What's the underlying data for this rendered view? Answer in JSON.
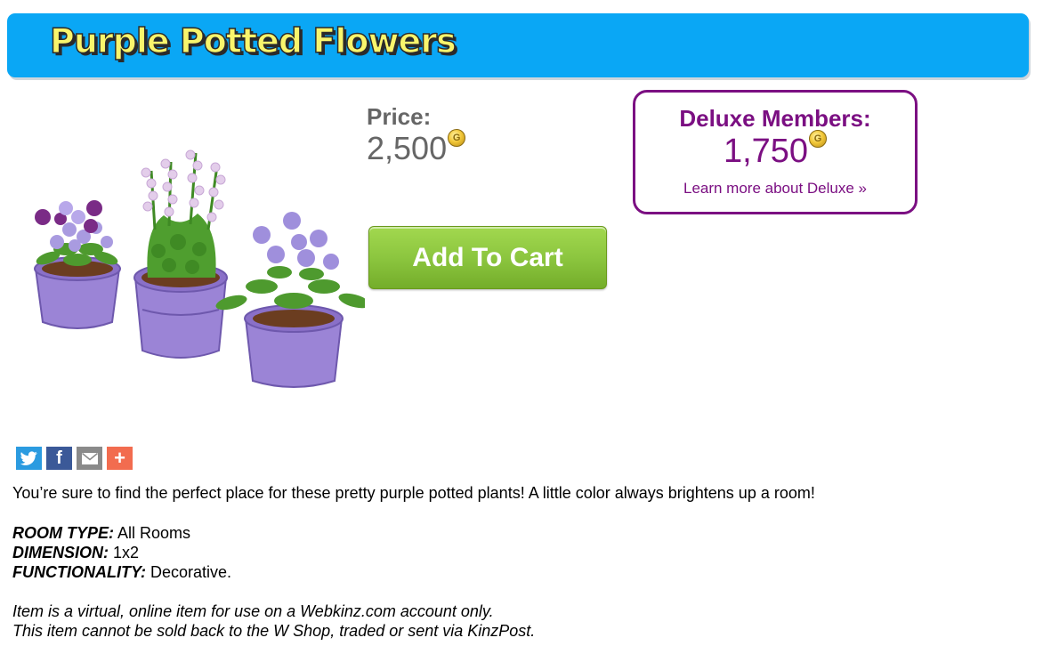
{
  "header": {
    "title": "Purple Potted Flowers"
  },
  "product": {
    "image_alt": "purple potted flowers illustration",
    "price_label": "Price:",
    "price_value": "2,500",
    "currency_icon": "kinzcash-coin-icon",
    "add_to_cart_label": "Add To Cart"
  },
  "deluxe": {
    "label": "Deluxe Members:",
    "price_value": "1,750",
    "link_text": "Learn more about Deluxe »"
  },
  "share": [
    {
      "name": "twitter",
      "icon": "twitter-icon",
      "color": "#2b9be0"
    },
    {
      "name": "facebook",
      "icon": "facebook-icon",
      "color": "#3b5998"
    },
    {
      "name": "email",
      "icon": "email-icon",
      "color": "#8a8a8a"
    },
    {
      "name": "more",
      "icon": "plus-icon",
      "color": "#f26c4f"
    }
  ],
  "description": "You’re sure to find the perfect place for these pretty purple potted plants! A little color always brightens up a room!",
  "specs": {
    "room_type_label": "ROOM TYPE:",
    "room_type_value": " All Rooms",
    "dimension_label": "DIMENSION:",
    "dimension_value": " 1x2",
    "functionality_label": "FUNCTIONALITY:",
    "functionality_value": " Decorative."
  },
  "disclaimer": {
    "line1": "Item is a virtual, online item for use on a Webkinz.com account only.",
    "line2": "This item cannot be sold back to the W Shop, traded or sent via KinzPost."
  },
  "colors": {
    "header_bg": "#0aa7f5",
    "title_yellow": "#f9f56c",
    "deluxe_purple": "#7b0f82",
    "button_green": "#8cc63f",
    "price_gray": "#666666"
  }
}
